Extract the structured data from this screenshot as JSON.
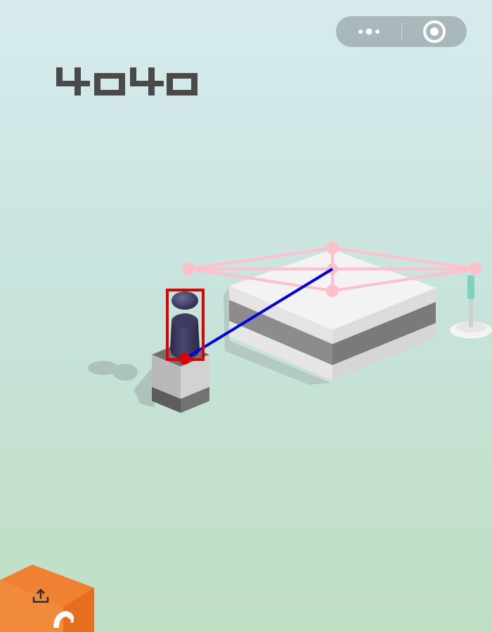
{
  "score": "4040",
  "menu_capsule": {
    "more_icon": "more-dots-icon",
    "close_icon": "target-close-icon"
  },
  "share_button": {
    "icon": "share-upload-icon"
  },
  "colors": {
    "background_top": "#d7ebef",
    "background_bottom": "#bfdfc4",
    "score_color": "#4a4a4a",
    "player_piece": "#3b3a5c",
    "aim_line": "#0000e0",
    "player_box": "#e00000",
    "platform_outline": "#ffc0cb",
    "share_tile": "#f08032"
  }
}
